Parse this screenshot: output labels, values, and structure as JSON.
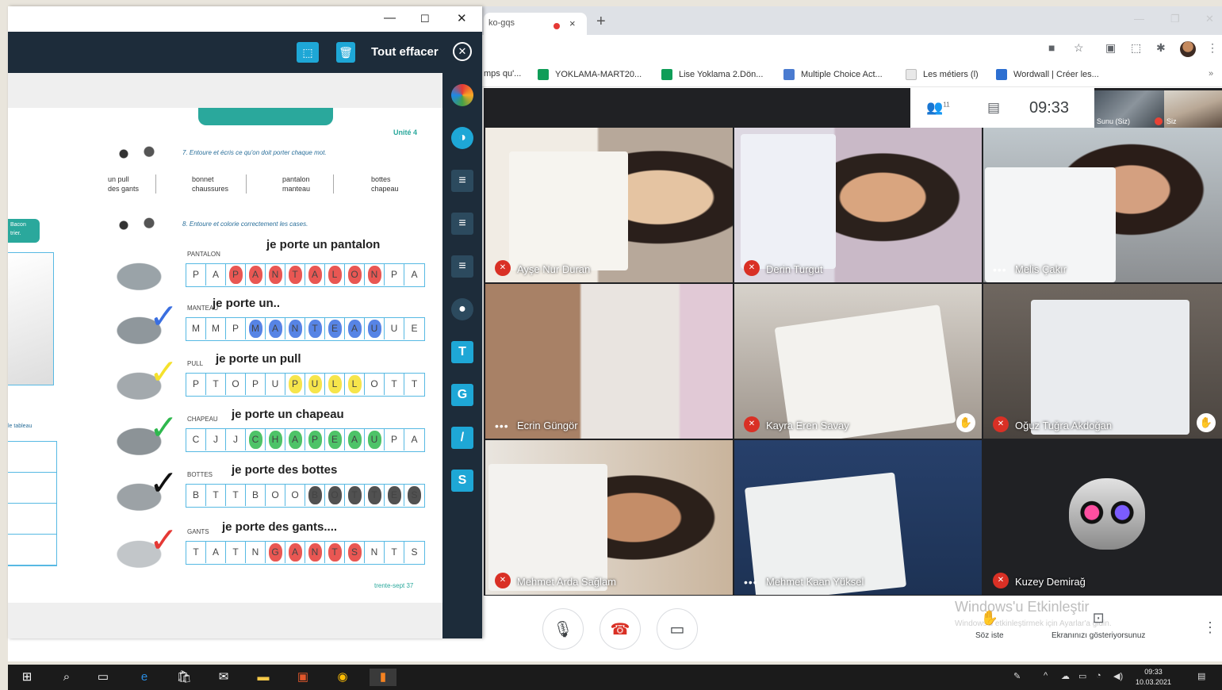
{
  "browser": {
    "tab_partial_title": "ko-gqs",
    "tab_close": "×",
    "new_tab": "+",
    "bookmarks": [
      {
        "label": "mps qu'...",
        "color": "#ffffff"
      },
      {
        "label": "YOKLAMA-MART20...",
        "color": "#0f9d58"
      },
      {
        "label": "Lise Yoklama 2.Dön...",
        "color": "#0f9d58"
      },
      {
        "label": "Multiple Choice Act...",
        "color": "#4a7bd0"
      },
      {
        "label": "Les métiers (l)",
        "color": "#f0f0f0"
      },
      {
        "label": "Wordwall | Créer les...",
        "color": "#2d6fd1"
      }
    ]
  },
  "meet": {
    "participants_icon": "people-icon",
    "participants_count": "11",
    "time": "09:33",
    "self_label": "Siz",
    "self_label2": "Sunu (Siz)",
    "tiles": [
      {
        "name": "Ayşe Nur Duran",
        "state": "muted"
      },
      {
        "name": "Derin Turgut",
        "state": "muted"
      },
      {
        "name": "Melis Çakır",
        "state": "talking"
      },
      {
        "name": "Ecrin Güngör",
        "state": "talking"
      },
      {
        "name": "Kayra Eren Savay",
        "state": "muted",
        "hand": true
      },
      {
        "name": "Oğuz Tuğra Akdoğan",
        "state": "muted",
        "hand": true
      },
      {
        "name": "Mehmet Arda Sağlam",
        "state": "muted"
      },
      {
        "name": "Mehmet Kaan Yüksel",
        "state": "talking"
      },
      {
        "name": "Kuzey Demirağ",
        "state": "muted"
      }
    ],
    "mute_icon": "✕",
    "dots_icon": "•••",
    "raise_hand_label": "Söz iste",
    "present_label": "Ekranınızı gösteriyorsunuz",
    "activation_title": "Windows'u Etkinleştir",
    "activation_sub": "Windows'u etkinleştirmek için Ayarlar'a gidin."
  },
  "book": {
    "clear_label": "Tout effacer",
    "unite": "Unité 4",
    "instr1": "7. Entoure et écris ce qu'on doit porter chaque mot.",
    "instr2": "8. Entoure et colorie correctement les cases.",
    "words": [
      {
        "a": "un pull",
        "b": "des gants"
      },
      {
        "a": "bonnet",
        "b": "chaussures"
      },
      {
        "a": "pantalon",
        "b": "manteau"
      },
      {
        "a": "bottes",
        "b": "chapeau"
      }
    ],
    "left_labels": [
      "Bacon",
      "trier.",
      "le tableau"
    ],
    "page_num": "trente-sept 37",
    "rows": [
      {
        "label": "PANTALON",
        "hw": "je porte un pantalon",
        "cells": [
          "P",
          "A",
          "P",
          "A",
          "N",
          "T",
          "A",
          "L",
          "O",
          "N",
          "P",
          "A"
        ],
        "marked": [
          2,
          3,
          4,
          5,
          6,
          7,
          8,
          9
        ],
        "color": "#e53935"
      },
      {
        "label": "MANTEAU",
        "hw": "je porte un..",
        "cells": [
          "M",
          "M",
          "P",
          "M",
          "A",
          "N",
          "T",
          "E",
          "A",
          "U",
          "U",
          "E"
        ],
        "marked": [
          3,
          4,
          5,
          6,
          7,
          8,
          9
        ],
        "color": "#3a6fe0"
      },
      {
        "label": "PULL",
        "hw": "je porte un pull",
        "cells": [
          "P",
          "T",
          "O",
          "P",
          "U",
          "P",
          "U",
          "L",
          "L",
          "O",
          "T",
          "T"
        ],
        "marked": [
          5,
          6,
          7,
          8
        ],
        "color": "#f5e12c"
      },
      {
        "label": "CHAPEAU",
        "hw": "je porte un chapeau",
        "cells": [
          "C",
          "J",
          "J",
          "C",
          "H",
          "A",
          "P",
          "E",
          "A",
          "U",
          "P",
          "A"
        ],
        "marked": [
          3,
          4,
          5,
          6,
          7,
          8,
          9
        ],
        "color": "#2fb84e"
      },
      {
        "label": "BOTTES",
        "hw": "je porte des bottes",
        "cells": [
          "B",
          "T",
          "T",
          "B",
          "O",
          "O",
          "B",
          "O",
          "T",
          "T",
          "E",
          "S"
        ],
        "marked": [
          6,
          7,
          8,
          9,
          10,
          11
        ],
        "color": "#333333"
      },
      {
        "label": "GANTS",
        "hw": "je porte des gants....",
        "cells": [
          "T",
          "A",
          "T",
          "N",
          "G",
          "A",
          "N",
          "T",
          "S",
          "N",
          "T",
          "S"
        ],
        "marked": [
          4,
          5,
          6,
          7,
          8
        ],
        "color": "#e53935"
      }
    ]
  },
  "taskbar": {
    "time": "09:33",
    "date": "10.03.2021"
  }
}
